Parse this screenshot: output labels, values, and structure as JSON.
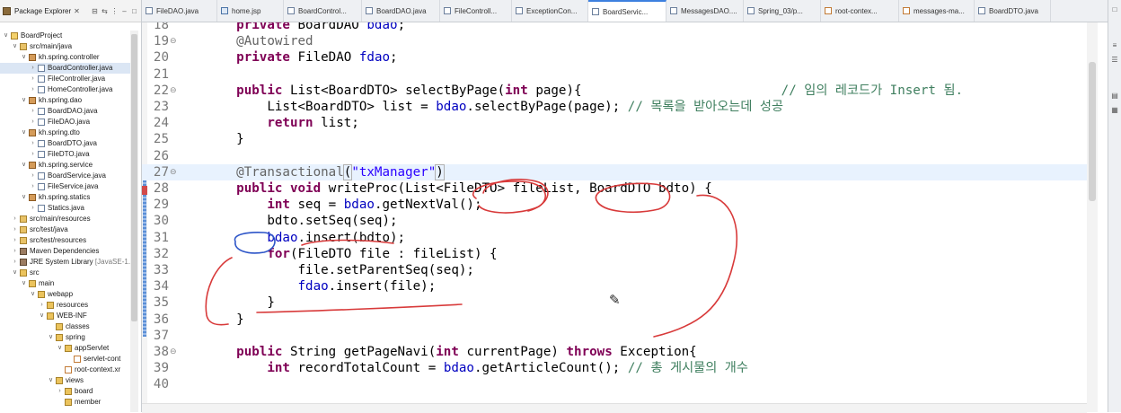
{
  "explorer": {
    "title": "Package Explorer",
    "close": "✕",
    "tree": [
      {
        "d": 0,
        "tw": "∨",
        "icon": "project",
        "label": "BoardProject"
      },
      {
        "d": 1,
        "tw": "∨",
        "icon": "srcfolder",
        "label": "src/main/java"
      },
      {
        "d": 2,
        "tw": "∨",
        "icon": "pkg",
        "label": "kh.spring.controller"
      },
      {
        "d": 3,
        "tw": "›",
        "icon": "java",
        "label": "BoardController.java",
        "sel": true
      },
      {
        "d": 3,
        "tw": "›",
        "icon": "java",
        "label": "FileController.java"
      },
      {
        "d": 3,
        "tw": "›",
        "icon": "java",
        "label": "HomeController.java"
      },
      {
        "d": 2,
        "tw": "∨",
        "icon": "pkg",
        "label": "kh.spring.dao"
      },
      {
        "d": 3,
        "tw": "›",
        "icon": "java",
        "label": "BoardDAO.java"
      },
      {
        "d": 3,
        "tw": "›",
        "icon": "java",
        "label": "FileDAO.java"
      },
      {
        "d": 2,
        "tw": "∨",
        "icon": "pkg",
        "label": "kh.spring.dto"
      },
      {
        "d": 3,
        "tw": "›",
        "icon": "java",
        "label": "BoardDTO.java"
      },
      {
        "d": 3,
        "tw": "›",
        "icon": "java",
        "label": "FileDTO.java"
      },
      {
        "d": 2,
        "tw": "∨",
        "icon": "pkg",
        "label": "kh.spring.service"
      },
      {
        "d": 3,
        "tw": "›",
        "icon": "java",
        "label": "BoardService.java"
      },
      {
        "d": 3,
        "tw": "›",
        "icon": "java",
        "label": "FileService.java"
      },
      {
        "d": 2,
        "tw": "∨",
        "icon": "pkg",
        "label": "kh.spring.statics"
      },
      {
        "d": 3,
        "tw": "›",
        "icon": "java",
        "label": "Statics.java"
      },
      {
        "d": 1,
        "tw": "›",
        "icon": "srcfolder",
        "label": "src/main/resources"
      },
      {
        "d": 1,
        "tw": "›",
        "icon": "srcfolder",
        "label": "src/test/java"
      },
      {
        "d": 1,
        "tw": "›",
        "icon": "srcfolder",
        "label": "src/test/resources"
      },
      {
        "d": 1,
        "tw": "›",
        "icon": "lib",
        "label": "Maven Dependencies"
      },
      {
        "d": 1,
        "tw": "›",
        "icon": "lib",
        "label": "JRE System Library",
        "dim": "[JavaSE-1."
      },
      {
        "d": 1,
        "tw": "∨",
        "icon": "folder",
        "label": "src"
      },
      {
        "d": 2,
        "tw": "∨",
        "icon": "folder",
        "label": "main"
      },
      {
        "d": 3,
        "tw": "∨",
        "icon": "folder",
        "label": "webapp"
      },
      {
        "d": 4,
        "tw": "›",
        "icon": "folder",
        "label": "resources"
      },
      {
        "d": 4,
        "tw": "∨",
        "icon": "folder",
        "label": "WEB-INF"
      },
      {
        "d": 5,
        "tw": "",
        "icon": "folder",
        "label": "classes"
      },
      {
        "d": 5,
        "tw": "∨",
        "icon": "folder",
        "label": "spring"
      },
      {
        "d": 6,
        "tw": "∨",
        "icon": "folder",
        "label": "appServlet"
      },
      {
        "d": 7,
        "tw": "",
        "icon": "xml",
        "label": "servlet-cont"
      },
      {
        "d": 6,
        "tw": "",
        "icon": "xml",
        "label": "root-context.xr"
      },
      {
        "d": 5,
        "tw": "∨",
        "icon": "folder",
        "label": "views"
      },
      {
        "d": 6,
        "tw": "›",
        "icon": "folder",
        "label": "board"
      },
      {
        "d": 6,
        "tw": "",
        "icon": "folder",
        "label": "member"
      }
    ]
  },
  "tabs": [
    {
      "label": "FileDAO.java",
      "icon": "java"
    },
    {
      "label": "home.jsp",
      "icon": "jsp"
    },
    {
      "label": "BoardControl...",
      "icon": "java"
    },
    {
      "label": "BoardDAO.java",
      "icon": "java"
    },
    {
      "label": "FileControll...",
      "icon": "java"
    },
    {
      "label": "ExceptionCon...",
      "icon": "java"
    },
    {
      "label": "BoardServic...",
      "icon": "java",
      "active": true
    },
    {
      "label": "MessagesDAO....",
      "icon": "java"
    },
    {
      "label": "Spring_03/p...",
      "icon": "java"
    },
    {
      "label": "root-contex...",
      "icon": "xml"
    },
    {
      "label": "messages-ma...",
      "icon": "xml"
    },
    {
      "label": "BoardDTO.java",
      "icon": "java"
    }
  ],
  "code": [
    {
      "n": "18",
      "t": [
        [
          "    "
        ],
        [
          "private ",
          "kw"
        ],
        [
          "BoardDAO "
        ],
        [
          "bdao",
          "fld"
        ],
        [
          ";"
        ]
      ]
    },
    {
      "n": "19",
      "fold": "⊖",
      "t": [
        [
          "    "
        ],
        [
          "@Autowired",
          "ann"
        ]
      ]
    },
    {
      "n": "20",
      "t": [
        [
          "    "
        ],
        [
          "private ",
          "kw"
        ],
        [
          "FileDAO "
        ],
        [
          "fdao",
          "fld"
        ],
        [
          ";"
        ]
      ]
    },
    {
      "n": "21",
      "t": [
        [
          ""
        ]
      ]
    },
    {
      "n": "22",
      "fold": "⊖",
      "t": [
        [
          "    "
        ],
        [
          "public ",
          "kw"
        ],
        [
          "List<BoardDTO> selectByPage("
        ],
        [
          "int ",
          "kw"
        ],
        [
          "page){                          "
        ],
        [
          "// 임의 레코드가 Insert 됨.",
          "cm"
        ]
      ]
    },
    {
      "n": "23",
      "t": [
        [
          "        List<BoardDTO> list = "
        ],
        [
          "bdao",
          "fld"
        ],
        [
          ".selectByPage(page); "
        ],
        [
          "// 목록을 받아오는데 성공",
          "cm"
        ]
      ]
    },
    {
      "n": "24",
      "t": [
        [
          "        "
        ],
        [
          "return ",
          "kw"
        ],
        [
          "list;"
        ]
      ]
    },
    {
      "n": "25",
      "t": [
        [
          "    }"
        ]
      ]
    },
    {
      "n": "26",
      "t": [
        [
          ""
        ]
      ]
    },
    {
      "n": "27",
      "fold": "⊖",
      "hl": true,
      "t": [
        [
          "    "
        ],
        [
          "@Transactional",
          "ann"
        ],
        [
          "(",
          "pbox"
        ],
        [
          "\"txManager\"",
          "str"
        ],
        [
          ")",
          "pbox"
        ]
      ]
    },
    {
      "n": "28",
      "t": [
        [
          "    "
        ],
        [
          "public ",
          "kw"
        ],
        [
          "void ",
          "kw"
        ],
        [
          "writeProc(List<FileDTO> fileList, BoardDTO bdto) {"
        ]
      ]
    },
    {
      "n": "29",
      "t": [
        [
          "        "
        ],
        [
          "int ",
          "kw"
        ],
        [
          "seq = "
        ],
        [
          "bdao",
          "fld"
        ],
        [
          ".getNextVal();"
        ]
      ]
    },
    {
      "n": "30",
      "t": [
        [
          "        bdto.setSeq(seq);"
        ]
      ]
    },
    {
      "n": "31",
      "t": [
        [
          "        "
        ],
        [
          "bdao",
          "fld"
        ],
        [
          ".insert(bdto);"
        ]
      ]
    },
    {
      "n": "32",
      "t": [
        [
          "        "
        ],
        [
          "for",
          "kw"
        ],
        [
          "(FileDTO file : fileList) {"
        ]
      ]
    },
    {
      "n": "33",
      "t": [
        [
          "            file.setParentSeq(seq);"
        ]
      ]
    },
    {
      "n": "34",
      "t": [
        [
          "            "
        ],
        [
          "fdao",
          "fld"
        ],
        [
          ".insert(file);"
        ]
      ]
    },
    {
      "n": "35",
      "t": [
        [
          "        }"
        ]
      ]
    },
    {
      "n": "36",
      "t": [
        [
          "    }"
        ]
      ]
    },
    {
      "n": "37",
      "t": [
        [
          ""
        ]
      ]
    },
    {
      "n": "38",
      "fold": "⊖",
      "t": [
        [
          "    "
        ],
        [
          "public ",
          "kw"
        ],
        [
          "String getPageNavi("
        ],
        [
          "int ",
          "kw"
        ],
        [
          "currentPage) "
        ],
        [
          "throws ",
          "kw"
        ],
        [
          "Exception{"
        ]
      ]
    },
    {
      "n": "39",
      "t": [
        [
          "        "
        ],
        [
          "int ",
          "kw"
        ],
        [
          "recordTotalCount = "
        ],
        [
          "bdao",
          "fld"
        ],
        [
          ".getArticleCount(); "
        ],
        [
          "// 총 게시물의 개수",
          "cm"
        ]
      ]
    },
    {
      "n": "40",
      "t": [
        [
          ""
        ]
      ]
    }
  ],
  "colors": {
    "annotation_ink": "#d83a3a",
    "annotation_ink_blue": "#2d55c8"
  }
}
